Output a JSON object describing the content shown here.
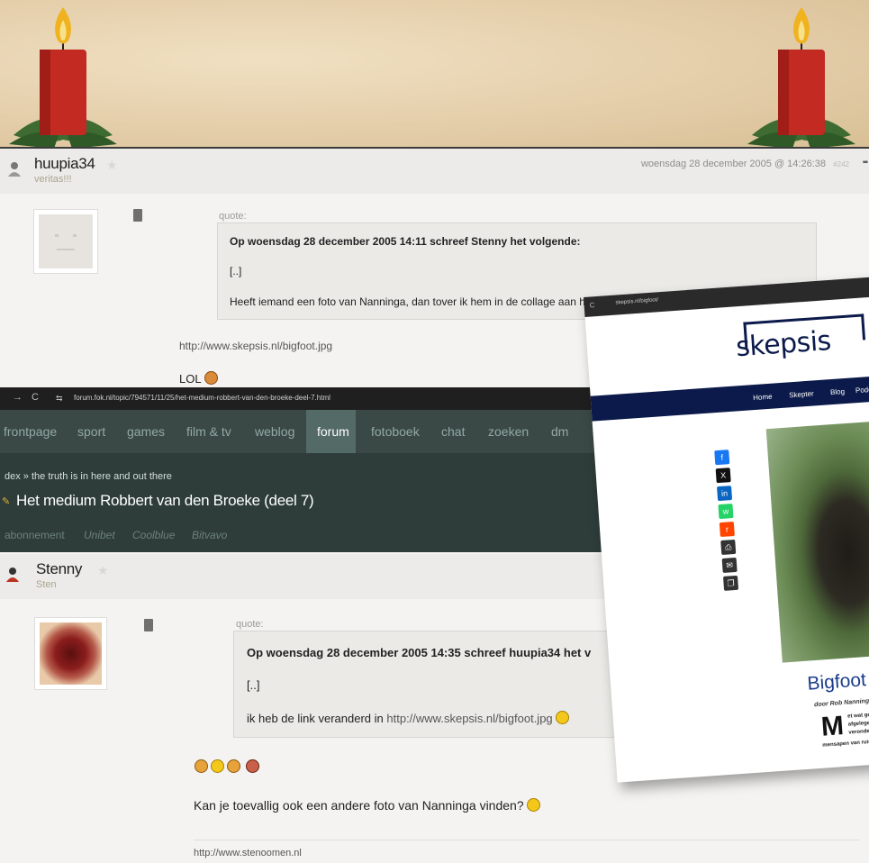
{
  "post1": {
    "username": "huupia34",
    "usertag": "veritas!!!",
    "date": "woensdag 28 december 2005 @ 14:26:38",
    "post_number": "#242",
    "quote_label": "quote:",
    "quote_title": "Op woensdag 28 december 2005 14:11 schreef Stenny het volgende:",
    "quote_ellipsis": "[..]",
    "quote_text": "Heeft iemand een foto van Nanninga, dan tover ik hem in de collage aan het begin van de topic!",
    "link": "http://www.skepsis.nl/bigfoot.jpg",
    "body": "LOL"
  },
  "fok": {
    "url": "forum.fok.nl/topic/794571/11/25/het-medium-robbert-van-den-broeke-deel-7.html",
    "nav": [
      "frontpage",
      "sport",
      "games",
      "film & tv",
      "weblog",
      "forum",
      "fotoboek",
      "chat",
      "zoeken",
      "dm"
    ],
    "active_nav": "forum",
    "breadcrumb": "dex  » the truth is in here and out there",
    "topic_title": "Het medium Robbert van den Broeke (deel 7)",
    "sponsor_label": "abonnement",
    "sponsors": [
      "Unibet",
      "Coolblue",
      "Bitvavo"
    ]
  },
  "post2": {
    "username": "Stenny",
    "usertag": "Sten",
    "quote_label": "quote:",
    "quote_title": "Op woensdag 28 december 2005 14:35 schreef huupia34 het v",
    "quote_ellipsis": "[..]",
    "quote_text": "ik heb de link veranderd in",
    "quote_link": "http://www.skepsis.nl/bigfoot.jpg",
    "body": "Kan je toevallig ook een andere foto van Nanninga vinden?",
    "signature": "http://www.stenoomen.nl"
  },
  "skepsis": {
    "url": "skepsis.nl/bigfoot/",
    "logo": "skepsis",
    "nav": [
      "Home",
      "Skepter",
      "Blog",
      "Podc"
    ],
    "share": [
      "f",
      "X",
      "in",
      "w",
      "r",
      "print",
      "mail",
      "copy"
    ],
    "title": "Bigfoot lee",
    "byline": "door Rob Nanninga",
    "dropcap": "M",
    "para_lines": [
      "et wat gevoel v",
      "afgelegen geb",
      "verondersteld",
      "mensapen van ruim tw"
    ]
  },
  "colors": {
    "fok_bg": "#2e3d3a",
    "skepsis_navy": "#0b1a4a",
    "skepsis_title": "#1a3c8c"
  }
}
